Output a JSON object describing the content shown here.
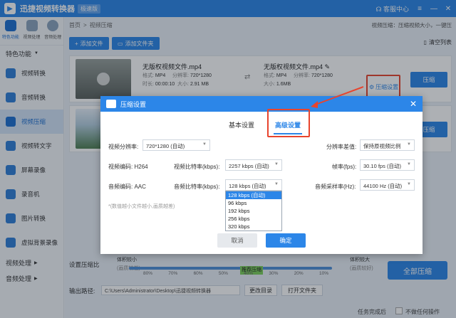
{
  "window": {
    "title": "迅捷视频转换器",
    "edition": "极速版",
    "service": "客服中心"
  },
  "topnav": [
    {
      "label": "特色功能"
    },
    {
      "label": "视频处理"
    },
    {
      "label": "音频处理"
    }
  ],
  "sidebar": {
    "section_features": "特色功能",
    "items": [
      {
        "label": "视频转换"
      },
      {
        "label": "音频转换"
      },
      {
        "label": "视频压缩"
      },
      {
        "label": "视频转文字"
      },
      {
        "label": "屏幕录像"
      },
      {
        "label": "录音机"
      },
      {
        "label": "图片转换"
      },
      {
        "label": "虚拟背景录像"
      }
    ],
    "section_video": "视频处理",
    "section_audio": "音频处理"
  },
  "breadcrumb": {
    "home": "首页",
    "sep": ">",
    "current": "视频压缩"
  },
  "top_info": "视频压缩：压缩视频大小，一键压",
  "toolbar": {
    "add_file": "添加文件",
    "add_folder": "添加文件夹",
    "clear_list": "清空列表"
  },
  "files": [
    {
      "name": "无版权视频文件.mp4",
      "format_label": "格式:",
      "format": "MP4",
      "resolution_label": "分辨率:",
      "resolution": "720*1280",
      "duration_label": "时长:",
      "duration": "00:00:10",
      "size_label": "大小:",
      "size": "2.91 MB",
      "out_name": "无版权视频文件.mp4",
      "out_format": "MP4",
      "out_resolution": "720*1280",
      "out_size": "1.6MB",
      "settings_link": "压缩设置",
      "compress_button": "压缩"
    },
    {
      "compress_button": "压缩"
    }
  ],
  "bottom": {
    "compress_ratio_label": "设置压缩比",
    "size_small": "体积较小",
    "size_small_sub": "(画质较差)",
    "size_large": "体积较大",
    "size_large_sub": "(画质较好)",
    "recommend": "推荐压缩",
    "ticks": [
      "80%",
      "70%",
      "60%",
      "50%",
      "40%",
      "30%",
      "20%",
      "10%"
    ],
    "slider_value_percent": 60,
    "output_path_label": "输出路径:",
    "output_path": "C:\\Users\\Administrator\\Desktop\\迅捷视频转换器",
    "change_dir": "更改目录",
    "open_folder": "打开文件夹",
    "compress_all": "全部压缩"
  },
  "status": {
    "done_label": "任务完成后",
    "shutdown_option": "不做任何操作"
  },
  "modal": {
    "title": "压缩设置",
    "tab_basic": "基本设置",
    "tab_advanced": "高级设置",
    "video_resolution_label": "视频分辨率:",
    "video_resolution": "720*1280 (自动)",
    "resolution_diff_label": "分辨率差值:",
    "resolution_diff": "保持原视频比例",
    "video_codec_label": "视频编码:",
    "video_codec": "H264",
    "video_bitrate_label": "视频比特率(kbps):",
    "video_bitrate": "2257 kbps (自动)",
    "fps_label": "帧率(fps):",
    "fps": "30.10 fps (自动)",
    "audio_codec_label": "音频编码:",
    "audio_codec": "AAC",
    "audio_bitrate_label": "音频比特率(kbps):",
    "audio_bitrate": "128 kbps (自动)",
    "sample_rate_label": "音频采样率(Hz):",
    "sample_rate": "44100 Hz (自动)",
    "note": "*(数值越小文件越小,画质越差)",
    "audio_bitrate_options": [
      "128 kbps (自动)",
      "96 kbps",
      "192 kbps",
      "256 kbps",
      "320 kbps"
    ],
    "cancel": "取消",
    "ok": "确定"
  },
  "colors": {
    "accent": "#2c86e8",
    "highlight": "#e8442d"
  }
}
